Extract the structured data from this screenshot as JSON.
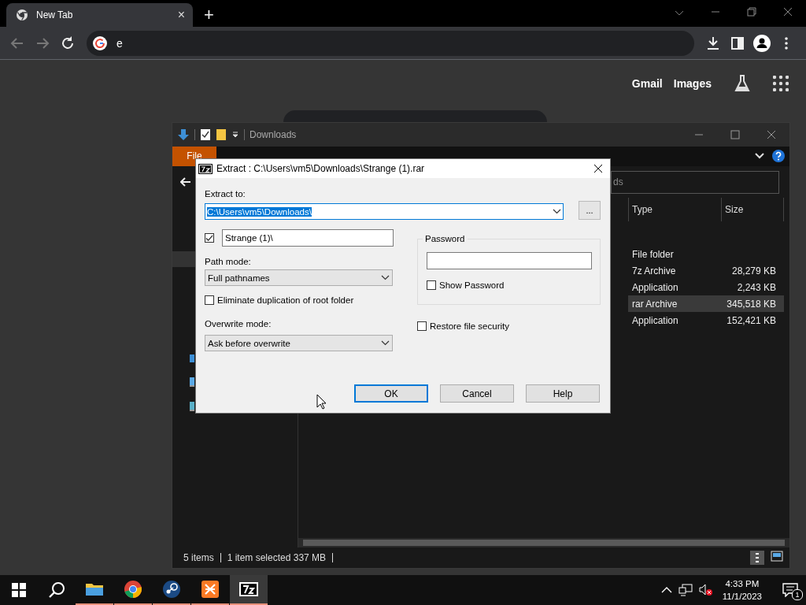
{
  "browser": {
    "tab": {
      "title": "New Tab",
      "close": "×"
    },
    "new_tab": "+",
    "address": {
      "value": "e"
    },
    "links": [
      "Gmail",
      "Images"
    ]
  },
  "explorer": {
    "title": "Downloads",
    "ribbon_tabs": [
      {
        "label": "File",
        "selected": true
      }
    ],
    "search": {
      "placeholder": "ds"
    },
    "columns": [
      "Type",
      "Size"
    ],
    "rows": [
      {
        "type": "File folder",
        "selected": false
      },
      {
        "type": "7z Archive",
        "size": "28,279 KB",
        "selected": false
      },
      {
        "type": "Application",
        "size": "2,243 KB",
        "selected": false
      },
      {
        "type": "rar Archive",
        "size": "345,518 KB",
        "selected": true
      },
      {
        "type": "Application",
        "size": "152,421 KB",
        "selected": false
      }
    ],
    "status": [
      "5 items",
      "1 item selected  337 MB"
    ]
  },
  "dialog": {
    "title": "Extract : C:\\Users\\vm5\\Downloads\\Strange (1).rar",
    "extract_to": {
      "label": "Extract to:",
      "value": "C:\\Users\\vm5\\Downloads\\",
      "text_selected": true
    },
    "browse": "...",
    "subfolder": {
      "checked": true,
      "value": "Strange (1)\\"
    },
    "path_mode": {
      "label": "Path mode:",
      "value": "Full pathnames"
    },
    "eliminate": {
      "label": "Eliminate duplication of root folder",
      "checked": false
    },
    "overwrite": {
      "label": "Overwrite mode:",
      "value": "Ask before overwrite"
    },
    "password": {
      "label": "Password",
      "show": {
        "label": "Show Password",
        "checked": false
      }
    },
    "restore": {
      "label": "Restore file security",
      "checked": false
    },
    "buttons": [
      {
        "label": "OK",
        "default": true
      },
      {
        "label": "Cancel",
        "default": false
      },
      {
        "label": "Help",
        "default": false
      }
    ]
  },
  "taskbar": {
    "apps": [
      {
        "kind": "explorer",
        "active": false
      },
      {
        "kind": "chrome",
        "active": false
      },
      {
        "kind": "steam",
        "active": false
      },
      {
        "kind": "xampp",
        "active": false
      },
      {
        "kind": "sevenzip",
        "active": true
      }
    ],
    "time": "4:33 PM",
    "date": "11/1/2023",
    "notifications": "1"
  }
}
